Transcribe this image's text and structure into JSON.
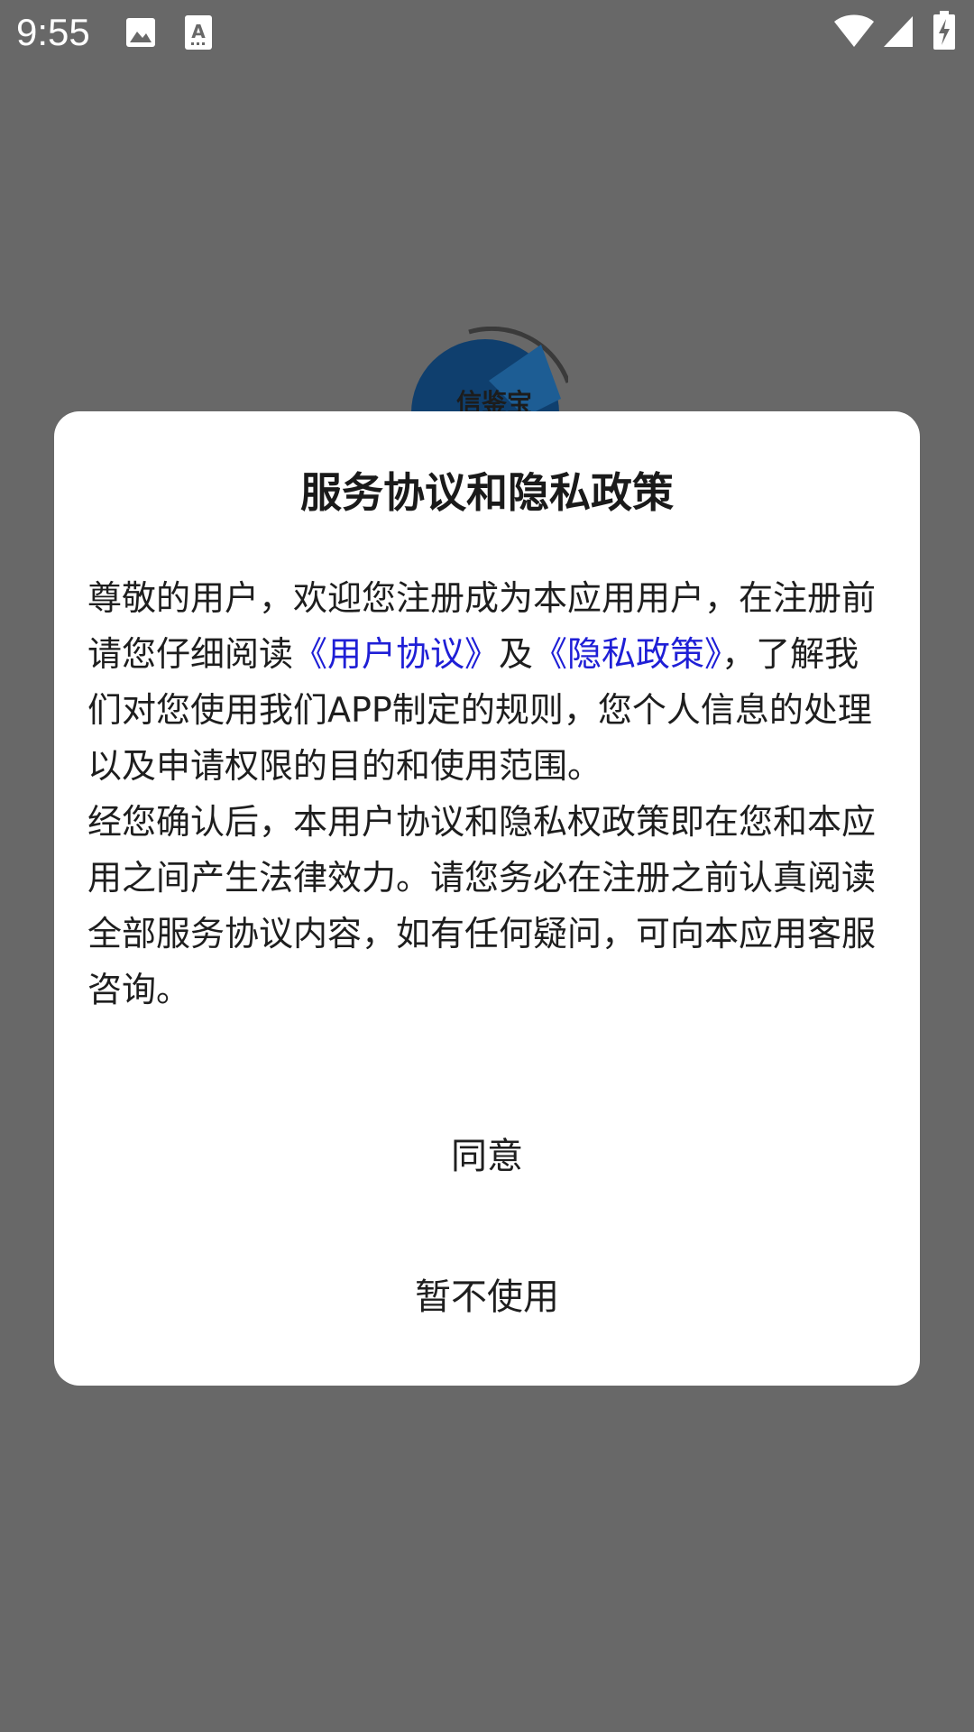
{
  "status_bar": {
    "time": "9:55",
    "icons_left": [
      "image-icon",
      "text-recognition-icon"
    ],
    "icons_right": [
      "wifi-icon",
      "cellular-signal-icon",
      "battery-charging-icon"
    ]
  },
  "background": {
    "logo_text": "信鉴宝"
  },
  "dialog": {
    "title": "服务协议和隐私政策",
    "body": {
      "p1_before_link1": "尊敬的用户，欢迎您注册成为本应用用户，在注册前请您仔细阅读",
      "link_user_agreement": "《用户协议》",
      "p1_between_links": "及",
      "link_privacy_policy": "《隐私政策》",
      "p1_after_link2": "，了解我们对您使用我们APP制定的规则，您个人信息的处理以及申请权限的目的和使用范围。",
      "p2": "经您确认后，本用户协议和隐私权政策即在您和本应用之间产生法律效力。请您务必在注册之前认真阅读全部服务协议内容，如有任何疑问，可向本应用客服咨询。"
    },
    "agree_label": "同意",
    "decline_label": "暂不使用"
  },
  "colors": {
    "scrim": "#686868",
    "dialog_bg": "#ffffff",
    "link": "#1f1fd6",
    "logo_blue": "#0f3f6e"
  }
}
